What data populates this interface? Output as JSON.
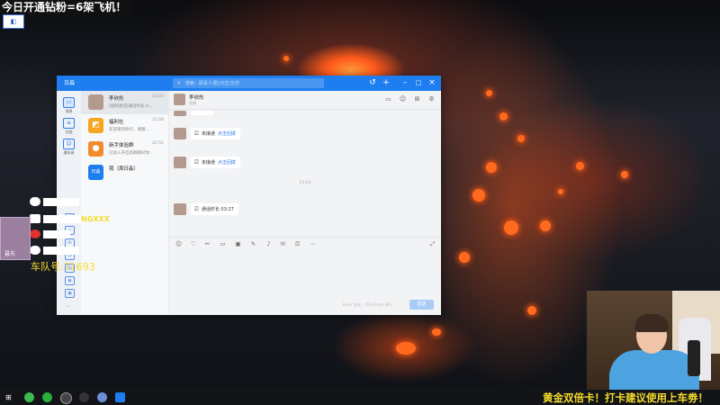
{
  "stream_overlay": {
    "top_text": "今日开通钻粉=6架飞机！",
    "team_text": "车队号:",
    "team_number": "71693",
    "team_tag": "NGXXX",
    "side_avatar_label": "聂东",
    "bottom_banner": "黄金双倍卡！打卡建议使用上车劵！"
  },
  "window": {
    "app_name": "日淼",
    "search_placeholder": "搜索：联系人/群/日志/文件",
    "titlebar_icons": [
      "history-icon",
      "add-icon",
      "minimize-icon",
      "maximize-icon",
      "close-icon"
    ]
  },
  "rail": {
    "items": [
      {
        "label": "消息",
        "icon": "chat-icon"
      },
      {
        "label": "文档",
        "icon": "doc-icon"
      },
      {
        "label": "通讯录",
        "icon": "contacts-icon"
      }
    ]
  },
  "conversations": [
    {
      "name": "李欣彤",
      "preview": "[视频通话]通话时长 0...",
      "time": "23:03",
      "avatar_color": "#b49a8e"
    },
    {
      "name": "福利社",
      "preview": "欢迎来到你们、请随...",
      "time": "22:58",
      "avatar_color": "#f5a623"
    },
    {
      "name": "新手体验群",
      "preview": "已加入开启新群都对你...",
      "time": "22:51",
      "avatar_color": "#f08c2b"
    },
    {
      "name": "我（周日淼）",
      "preview": "",
      "time": "",
      "avatar_color": "#1e7ef0",
      "avatar_text": "日淼"
    }
  ],
  "chat": {
    "contact_name": "李欣彤",
    "contact_sub": "在线",
    "messages": [
      {
        "text": "未接通",
        "action": "点击回拨"
      },
      {
        "text": "未接通",
        "action": "点击回拨"
      },
      {
        "text": "通话时长 03:27",
        "action": ""
      }
    ],
    "time_divider": "23:03",
    "send_hint": "Enter 发送，Ctrl+Enter 换行",
    "send_label": "发送"
  },
  "colors": {
    "titlebar": "#1e7ef0",
    "overlay_yellow": "#f6dc2b",
    "link_blue": "#2f7df0"
  }
}
